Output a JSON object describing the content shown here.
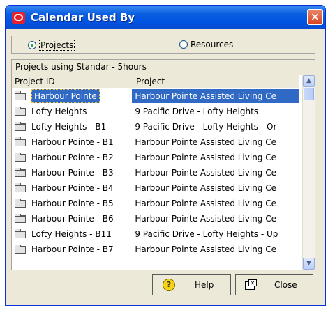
{
  "window": {
    "title": "Calendar Used By",
    "close_glyph": "✕"
  },
  "filter": {
    "options": [
      {
        "label": "Projects",
        "selected": true
      },
      {
        "label": "Resources",
        "selected": false
      }
    ]
  },
  "panel": {
    "caption": "Projects using Standar - 5hours",
    "columns": [
      "Project ID",
      "Project"
    ],
    "rows": [
      {
        "id": "Harbour Pointe",
        "project": "Harbour Pointe Assisted Living Ce",
        "selected": true
      },
      {
        "id": "Lofty Heights",
        "project": "9 Pacific Drive - Lofty Heights"
      },
      {
        "id": "Lofty Heights - B1",
        "project": "9 Pacific Drive - Lofty Heights - Or"
      },
      {
        "id": "Harbour Pointe - B1",
        "project": "Harbour Pointe Assisted Living Ce"
      },
      {
        "id": "Harbour Pointe - B2",
        "project": "Harbour Pointe Assisted Living Ce"
      },
      {
        "id": "Harbour Pointe - B3",
        "project": "Harbour Pointe Assisted Living Ce"
      },
      {
        "id": "Harbour Pointe - B4",
        "project": "Harbour Pointe Assisted Living Ce"
      },
      {
        "id": "Harbour Pointe - B5",
        "project": "Harbour Pointe Assisted Living Ce"
      },
      {
        "id": "Harbour Pointe - B6",
        "project": "Harbour Pointe Assisted Living Ce"
      },
      {
        "id": "Lofty Heights - B11",
        "project": "9 Pacific Drive - Lofty Heights - Up"
      },
      {
        "id": "Harbour Pointe - B7",
        "project": "Harbour Pointe Assisted Living Ce"
      }
    ]
  },
  "buttons": {
    "help_label": "Help",
    "help_glyph": "?",
    "close_label": "Close"
  },
  "icons": {
    "row_icon": "folder-icon",
    "help_icon": "help-icon",
    "close_icon": "close-window-icon"
  },
  "colors": {
    "titlebar": "#0053e1",
    "selection": "#316ac5",
    "close_button": "#d6431d",
    "app_icon": "#e8202a"
  }
}
